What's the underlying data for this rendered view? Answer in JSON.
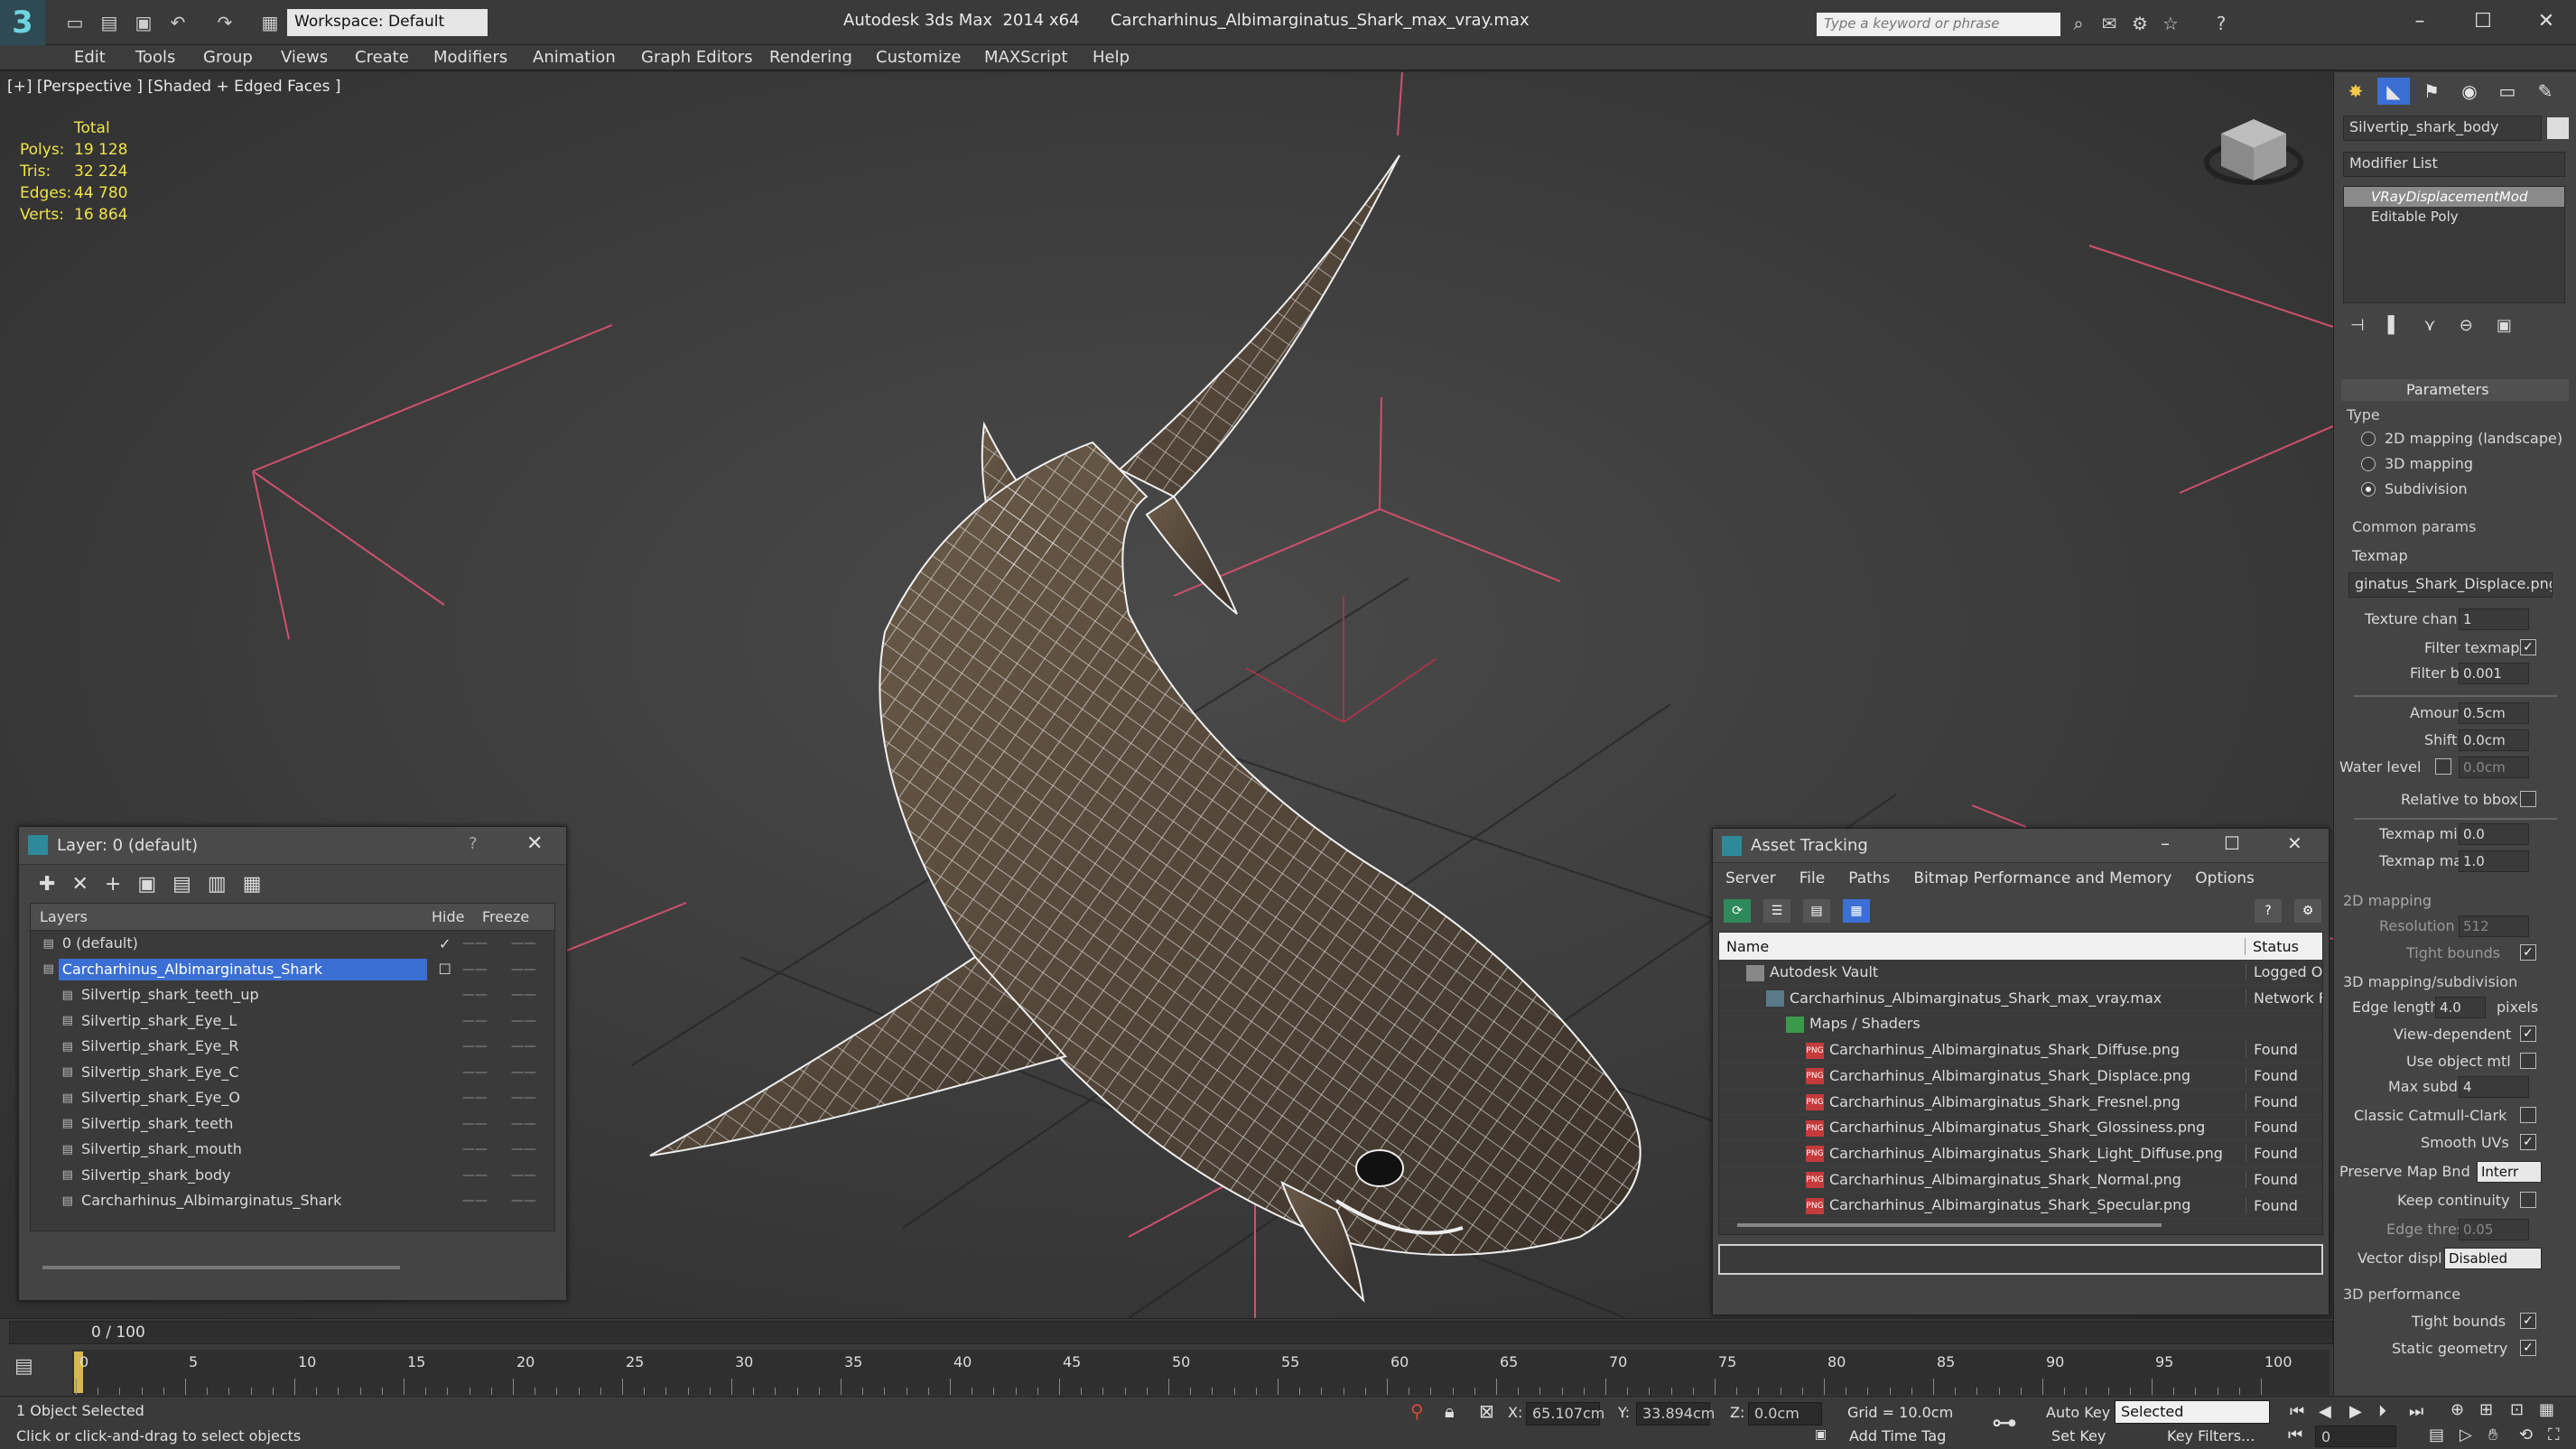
{
  "titlebar": {
    "logo": "3",
    "workspace": "Workspace: Default",
    "title": "Autodesk 3ds Max  2014 x64      Carcharhinus_Albimarginatus_Shark_max_vray.max",
    "search_placeholder": "Type a keyword or phrase",
    "help_label": "?"
  },
  "menu": [
    "Edit",
    "Tools",
    "Group",
    "Views",
    "Create",
    "Modifiers",
    "Animation",
    "Graph Editors",
    "Rendering",
    "Customize",
    "MAXScript",
    "Help"
  ],
  "viewport": {
    "label": "[+] [Perspective ] [Shaded + Edged Faces ]",
    "stats": {
      "header": "Total",
      "polys_label": "Polys:",
      "polys": "19 128",
      "tris_label": "Tris:",
      "tris": "32 224",
      "edges_label": "Edges:",
      "edges": "44 780",
      "verts_label": "Verts:",
      "verts": "16 864"
    }
  },
  "layer_panel": {
    "title": "Layer: 0 (default)",
    "help": "?",
    "col_layers": "Layers",
    "col_hide": "Hide",
    "col_freeze": "Freeze",
    "rows": [
      {
        "name": "0 (default)",
        "indent": 1,
        "check": "✓"
      },
      {
        "name": "Carcharhinus_Albimarginatus_Shark",
        "indent": 1,
        "selected": true
      },
      {
        "name": "Silvertip_shark_teeth_up",
        "indent": 2
      },
      {
        "name": "Silvertip_shark_Eye_L",
        "indent": 2
      },
      {
        "name": "Silvertip_shark_Eye_R",
        "indent": 2
      },
      {
        "name": "Silvertip_shark_Eye_C",
        "indent": 2
      },
      {
        "name": "Silvertip_shark_Eye_O",
        "indent": 2
      },
      {
        "name": "Silvertip_shark_teeth",
        "indent": 2
      },
      {
        "name": "Silvertip_shark_mouth",
        "indent": 2
      },
      {
        "name": "Silvertip_shark_body",
        "indent": 2
      },
      {
        "name": "Carcharhinus_Albimarginatus_Shark",
        "indent": 2
      }
    ]
  },
  "asset_panel": {
    "title": "Asset Tracking",
    "menu": [
      "Server",
      "File",
      "Paths",
      "Bitmap Performance and Memory",
      "Options"
    ],
    "col_name": "Name",
    "col_status": "Status",
    "rows": [
      {
        "name": "Autodesk Vault",
        "status": "Logged O",
        "indent": 1,
        "kind": "vault"
      },
      {
        "name": "Carcharhinus_Albimarginatus_Shark_max_vray.max",
        "status": "Network F",
        "indent": 2,
        "kind": "max"
      },
      {
        "name": "Maps / Shaders",
        "status": "",
        "indent": 3,
        "kind": "folder"
      },
      {
        "name": "Carcharhinus_Albimarginatus_Shark_Diffuse.png",
        "status": "Found",
        "indent": 4,
        "kind": "png"
      },
      {
        "name": "Carcharhinus_Albimarginatus_Shark_Displace.png",
        "status": "Found",
        "indent": 4,
        "kind": "png"
      },
      {
        "name": "Carcharhinus_Albimarginatus_Shark_Fresnel.png",
        "status": "Found",
        "indent": 4,
        "kind": "png"
      },
      {
        "name": "Carcharhinus_Albimarginatus_Shark_Glossiness.png",
        "status": "Found",
        "indent": 4,
        "kind": "png"
      },
      {
        "name": "Carcharhinus_Albimarginatus_Shark_Light_Diffuse.png",
        "status": "Found",
        "indent": 4,
        "kind": "png"
      },
      {
        "name": "Carcharhinus_Albimarginatus_Shark_Normal.png",
        "status": "Found",
        "indent": 4,
        "kind": "png"
      },
      {
        "name": "Carcharhinus_Albimarginatus_Shark_Specular.png",
        "status": "Found",
        "indent": 4,
        "kind": "png"
      }
    ]
  },
  "command_panel": {
    "object_name": "Silvertip_shark_body",
    "modifier_list": "Modifier List",
    "stack": [
      "VRayDisplacementMod",
      "Editable Poly"
    ],
    "parameters": "Parameters",
    "type_label": "Type",
    "type_options": [
      "2D mapping (landscape)",
      "3D mapping",
      "Subdivision"
    ],
    "common_params": "Common params",
    "texmap_label": "Texmap",
    "texmap_value": "ginatus_Shark_Displace.png)",
    "texture_chan_label": "Texture chan",
    "texture_chan": "1",
    "filter_texmap_label": "Filter texmap",
    "filter_blur_label": "Filter blur",
    "filter_blur": "0.001",
    "amount_label": "Amount",
    "amount": "0.5cm",
    "shift_label": "Shift",
    "shift": "0.0cm",
    "water_level_label": "Water level",
    "water_level": "0.0cm",
    "relative_bbox_label": "Relative to bbox",
    "texmap_min_label": "Texmap min",
    "texmap_min": "0.0",
    "texmap_max_label": "Texmap max",
    "texmap_max": "1.0",
    "mapping2d_label": "2D mapping",
    "resolution_label": "Resolution",
    "resolution": "512",
    "tight_bounds_label": "Tight bounds",
    "sub3d_label": "3D mapping/subdivision",
    "edge_length_label": "Edge length",
    "edge_length": "4.0",
    "pixels_label": "pixels",
    "view_dependent_label": "View-dependent",
    "use_object_mtl_label": "Use object mtl",
    "max_subdivs_label": "Max subdivs",
    "max_subdivs": "4",
    "catmull_label": "Classic Catmull-Clark",
    "smooth_uvs_label": "Smooth UVs",
    "preserve_map_label": "Preserve Map Bnd",
    "preserve_map": "Interr",
    "keep_continuity_label": "Keep continuity",
    "edge_thresh_label": "Edge thresh",
    "edge_thresh": "0.05",
    "vector_displ_label": "Vector displ",
    "vector_displ": "Disabled",
    "perf_label": "3D performance",
    "tight_bounds2_label": "Tight bounds",
    "static_geometry_label": "Static geometry"
  },
  "timeline": {
    "frame": "0 / 100",
    "ticks": [
      0,
      5,
      10,
      15,
      20,
      25,
      30,
      35,
      40,
      45,
      50,
      55,
      60,
      65,
      70,
      75,
      80,
      85,
      90,
      95,
      100
    ]
  },
  "status": {
    "selected": "1 Object Selected",
    "hint": "Click or click-and-drag to select objects",
    "x_label": "X:",
    "x": "65.107cm",
    "y_label": "Y:",
    "y": "33.894cm",
    "z_label": "Z:",
    "z": "0.0cm",
    "grid": "Grid = 10.0cm",
    "add_time_tag": "Add Time Tag",
    "auto_key": "Auto Key",
    "set_key": "Set Key",
    "selected_dropdown": "Selected",
    "key_filters": "Key Filters...",
    "frame_value": "0"
  },
  "colors": {
    "accent": "#3b6fd4",
    "stats_text": "#f0e34a",
    "grid_pink": "#d05070",
    "viewport_bg": "#3d3d3d"
  }
}
